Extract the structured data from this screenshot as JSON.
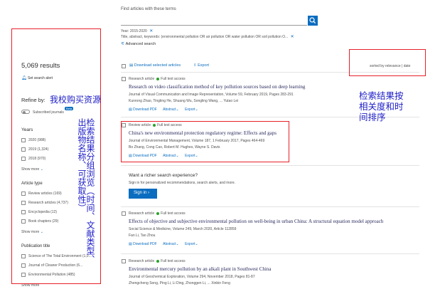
{
  "search": {
    "heading": "Find articles with these terms",
    "filters": {
      "year": "Year: 2015-2020",
      "keywords": "Title, abstract, keywords: (environmental pollution OR air pollution OR water pollution OR soil pollution O...",
      "advanced": "Advanced search"
    }
  },
  "sidebar": {
    "results_count": "5,069 results",
    "set_alert": "Set search alert",
    "refine_by": "Refine by:",
    "subscribed_toggle": "Subscribed journals",
    "toggle_badge": "Beta",
    "years_heading": "Years",
    "years": [
      {
        "label": "2020 (988)"
      },
      {
        "label": "2019 (1,324)"
      },
      {
        "label": "2018 (970)"
      }
    ],
    "show_more_1": "Show more",
    "article_type_heading": "Article type",
    "article_types": [
      {
        "label": "Review articles (169)"
      },
      {
        "label": "Research articles (4,737)"
      },
      {
        "label": "Encyclopedia (12)"
      },
      {
        "label": "Book chapters (29)"
      }
    ],
    "show_more_2": "Show more",
    "publication_heading": "Publication title",
    "publications": [
      {
        "label": "Science of The Total Environment (1,0..."
      },
      {
        "label": "Journal of Cleaner Production (6..."
      },
      {
        "label": "Environmental Pollution (485)"
      }
    ],
    "show_more_3": "Show more"
  },
  "toolbar": {
    "download_selected": "Download selected articles",
    "export": "Export",
    "sorted_by": "sorted by relevance | date"
  },
  "results": [
    {
      "type": "Research article",
      "access": "Full text access",
      "title": "Research on video classification method of key pollution sources based on deep learning",
      "source": "Journal of Visual Communication and Image Representation, Volume 59, February 2019, Pages 283-291",
      "authors": "Kunrong Zhao, Tingting He, Shuang Wu, Songling Wang, ... Yutao Lei",
      "pdf": "Download PDF",
      "abstract": "Abstract",
      "export": "Export"
    },
    {
      "type": "Review article",
      "access": "Full text access",
      "title": "China's new environmental protection regulatory regime: Effects and gaps",
      "source": "Journal of Environmental Management, Volume 187, 1 February 2017, Pages 464-469",
      "authors": "Bo Zhang, Cong Cao, Robert M. Hughes, Wayne S. Davis",
      "pdf": "Download PDF",
      "abstract": "Abstract",
      "export": "Export"
    },
    {
      "type": "Research article",
      "access": "Full text access",
      "title": "Effects of objective and subjective environmental pollution on well-being in urban China: A structural equation model approach",
      "source": "Social Science & Medicine, Volume 249, March 2020, Article 112859",
      "authors": "Fan Li, Tao Zhou",
      "pdf": "Download PDF",
      "abstract": "Abstract",
      "export": "Export"
    },
    {
      "type": "Research article",
      "access": "Full text access",
      "title": "Environmental mercury pollution by an alkali plant in Southwest China",
      "source": "Journal of Geochemical Exploration, Volume 294, November 2018, Pages 81-87",
      "authors": "Zhengcheng Song, Ping Li, Li Ding, Zhonggen Li, ... Xinbin Feng"
    }
  ],
  "promo": {
    "heading": "Want a richer search experience?",
    "text": "Sign in for personalized recommendations, search alerts, and more.",
    "sign_in": "Sign in"
  },
  "annotations": {
    "subscribed": "我校购买资源",
    "facets": "检索结果分组浏览（时间、文献类型、出版物名称、可获取性）",
    "sort": "检索结果按相关度和时间排序"
  },
  "colors": {
    "accent": "#0b6dc0",
    "annotation_box": "#e8202a",
    "annotation_text": "#1d1dc8",
    "open_access": "#29a329"
  }
}
